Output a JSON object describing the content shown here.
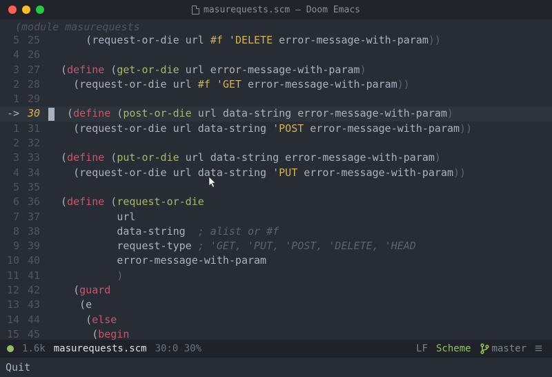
{
  "window": {
    "title": "masurequests.scm — Doom Emacs"
  },
  "module_hint": "(module masurequests",
  "lines": [
    {
      "rel": "5",
      "abs": "25",
      "code": "      (request-or-die url #f 'DELETE error-message-with-param))"
    },
    {
      "rel": "4",
      "abs": "26",
      "code": ""
    },
    {
      "rel": "3",
      "abs": "27",
      "code": "  (define (get-or-die url error-message-with-param)"
    },
    {
      "rel": "2",
      "abs": "28",
      "code": "    (request-or-die url #f 'GET error-message-with-param))"
    },
    {
      "rel": "1",
      "abs": "29",
      "code": ""
    },
    {
      "rel": "->",
      "abs": "30",
      "code": "  (define (post-or-die url data-string error-message-with-param)",
      "current": true
    },
    {
      "rel": "1",
      "abs": "31",
      "code": "    (request-or-die url data-string 'POST error-message-with-param))"
    },
    {
      "rel": "2",
      "abs": "32",
      "code": ""
    },
    {
      "rel": "3",
      "abs": "33",
      "code": "  (define (put-or-die url data-string error-message-with-param)"
    },
    {
      "rel": "4",
      "abs": "34",
      "code": "    (request-or-die url data-string 'PUT error-message-with-param))"
    },
    {
      "rel": "5",
      "abs": "35",
      "code": ""
    },
    {
      "rel": "6",
      "abs": "36",
      "code": "  (define (request-or-die"
    },
    {
      "rel": "7",
      "abs": "37",
      "code": "           url"
    },
    {
      "rel": "8",
      "abs": "38",
      "code": "           data-string  ; alist or #f"
    },
    {
      "rel": "9",
      "abs": "39",
      "code": "           request-type ; 'GET, 'PUT, 'POST, 'DELETE, 'HEAD"
    },
    {
      "rel": "10",
      "abs": "40",
      "code": "           error-message-with-param"
    },
    {
      "rel": "11",
      "abs": "41",
      "code": "           )"
    },
    {
      "rel": "12",
      "abs": "42",
      "code": "    (guard"
    },
    {
      "rel": "13",
      "abs": "43",
      "code": "     (e"
    },
    {
      "rel": "14",
      "abs": "44",
      "code": "      (else"
    },
    {
      "rel": "15",
      "abs": "45",
      "code": "       (begin"
    }
  ],
  "modeline": {
    "size": "1.6k",
    "filename": "masurequests.scm",
    "position": "30:0 30%",
    "encoding": "LF",
    "mode": "Scheme",
    "branch": "master",
    "menu_glyph": "≡"
  },
  "minibuffer": "Quit"
}
